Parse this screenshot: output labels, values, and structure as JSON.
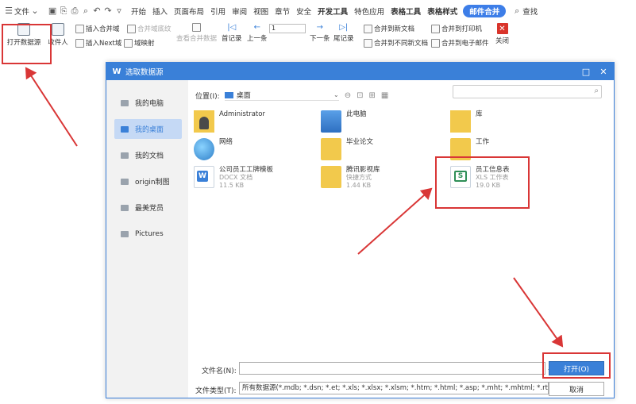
{
  "menubar": {
    "file_menu": "文件",
    "tabs": [
      "开始",
      "插入",
      "页面布局",
      "引用",
      "审阅",
      "视图",
      "章节",
      "安全",
      "开发工具",
      "特色应用",
      "表格工具",
      "表格样式"
    ],
    "active_tab": "邮件合并",
    "search": "查找"
  },
  "ribbon": {
    "open_datasource": "打开数据源",
    "recipients": "收件人",
    "insert_merge_field": "插入合并域",
    "merge_field_highlight": "合并域底纹",
    "insert_next": "插入Next域",
    "field_map": "域映射",
    "view_merged": "查看合并数据",
    "first_record": "首记录",
    "prev_record": "上一条",
    "record_number": "1",
    "next_record": "下一条",
    "last_record": "尾记录",
    "merge_new_doc": "合并到新文档",
    "merge_separate_docs": "合并到不同新文档",
    "merge_printer": "合并到打印机",
    "merge_email": "合并到电子邮件",
    "close": "关闭"
  },
  "dialog": {
    "title": "选取数据源",
    "location_label": "位置(I):",
    "location_value": "桌面",
    "places": [
      {
        "label": "我的电脑",
        "selected": false
      },
      {
        "label": "我的桌面",
        "selected": true
      },
      {
        "label": "我的文档",
        "selected": false
      },
      {
        "label": "origin制图",
        "selected": false
      },
      {
        "label": "最美党员",
        "selected": false
      },
      {
        "label": "Pictures",
        "selected": false
      }
    ],
    "files": [
      {
        "name": "Administrator",
        "type": "",
        "size": "",
        "icon": "user-folder-icon"
      },
      {
        "name": "此电脑",
        "type": "",
        "size": "",
        "icon": "computer-icon"
      },
      {
        "name": "库",
        "type": "",
        "size": "",
        "icon": "library-icon"
      },
      {
        "name": "网络",
        "type": "",
        "size": "",
        "icon": "network-icon"
      },
      {
        "name": "毕业论文",
        "type": "",
        "size": "",
        "icon": "folder-icon"
      },
      {
        "name": "工作",
        "type": "",
        "size": "",
        "icon": "folder-icon"
      },
      {
        "name": "公司员工工牌模板",
        "type": "DOCX 文档",
        "size": "11.5 KB",
        "icon": "word-doc-icon"
      },
      {
        "name": "腾讯影视库",
        "type": "快捷方式",
        "size": "1.44 KB",
        "icon": "shortcut-folder-icon"
      },
      {
        "name": "员工信息表",
        "type": "XLS 工作表",
        "size": "19.0 KB",
        "icon": "spreadsheet-icon"
      }
    ],
    "filename_label": "文件名(N):",
    "filename_value": "",
    "filetype_label": "文件类型(T):",
    "filetype_value": "所有数据源(*.mdb; *.dsn; *.et; *.xls; *.xlsx; *.xlsm; *.htm; *.html; *.asp; *.mht; *.mhtml; *.rtf; *.docx; *.do",
    "open_button": "打开(O)",
    "cancel_button": "取消"
  },
  "colors": {
    "accent": "#3a80d8",
    "annotation": "#d93636"
  }
}
